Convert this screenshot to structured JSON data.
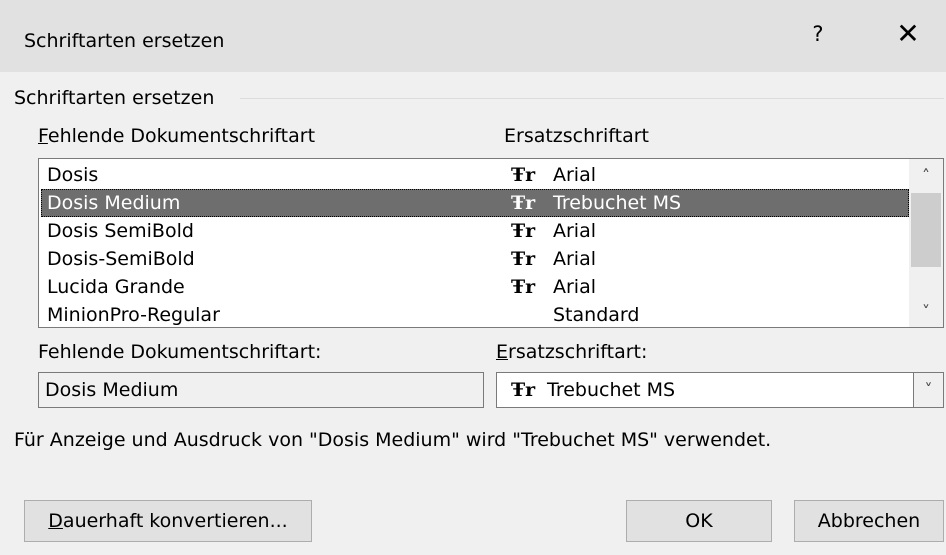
{
  "dialog": {
    "title": "Schriftarten ersetzen",
    "help_label": "?",
    "close_label": "✕"
  },
  "group": {
    "label": "Schriftarten ersetzen"
  },
  "list": {
    "header_missing_first": "F",
    "header_missing_rest": "ehlende Dokumentschriftart",
    "header_replace": "Ersatzschriftart",
    "rows": [
      {
        "missing": "Dosis",
        "tt": "Ŧr",
        "replace": "Arial",
        "selected": false
      },
      {
        "missing": "Dosis Medium",
        "tt": "Ŧr",
        "replace": "Trebuchet MS",
        "selected": true
      },
      {
        "missing": "Dosis SemiBold",
        "tt": "Ŧr",
        "replace": "Arial",
        "selected": false
      },
      {
        "missing": "Dosis-SemiBold",
        "tt": "Ŧr",
        "replace": "Arial",
        "selected": false
      },
      {
        "missing": "Lucida Grande",
        "tt": "Ŧr",
        "replace": "Arial",
        "selected": false
      },
      {
        "missing": "MinionPro-Regular",
        "tt": "",
        "replace": "Standard",
        "selected": false
      }
    ],
    "scroll_up": "˄",
    "scroll_down": "˅"
  },
  "fields": {
    "missing_label": "Fehlende Dokumentschriftart:",
    "missing_value": "Dosis Medium",
    "replace_label_first": "E",
    "replace_label_rest": "rsatzschriftart:",
    "replace_tt": "Ŧr",
    "replace_value": "Trebuchet MS",
    "combo_arrow": "˅"
  },
  "info_text": "Für Anzeige und Ausdruck von \"Dosis Medium\" wird \"Trebuchet MS\" verwendet.",
  "buttons": {
    "convert_first": "D",
    "convert_rest": "auerhaft konvertieren...",
    "ok": "OK",
    "cancel": "Abbrechen"
  },
  "colors": {
    "selection": "#6e6e6e",
    "titlebar": "#e1e1e1",
    "dialog_bg": "#f0f0f0"
  }
}
